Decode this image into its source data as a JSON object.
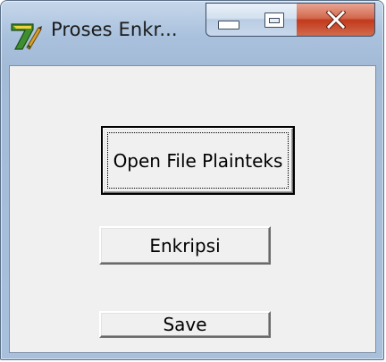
{
  "window": {
    "title": "Proses Enkr..."
  },
  "icons": {
    "app": "delphi-app-icon",
    "minimize": "minimize-icon",
    "maximize": "maximize-icon",
    "close": "close-icon"
  },
  "colors": {
    "close_button": "#c2391b",
    "client_background": "#f0f0f0",
    "frame": "#a9c1dd"
  },
  "buttons": {
    "open_file": "Open File Plainteks",
    "encrypt": "Enkripsi",
    "save": "Save"
  }
}
